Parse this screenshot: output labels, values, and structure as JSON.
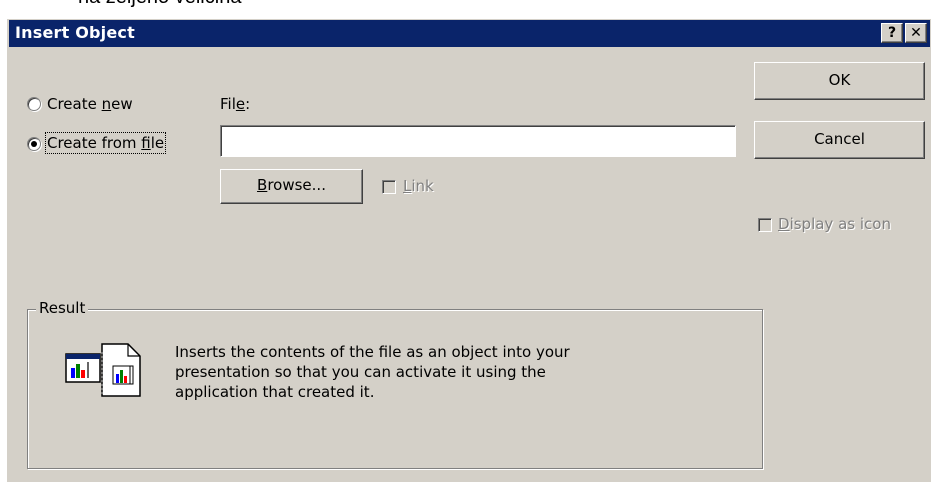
{
  "background_text": "na zeljeno velicina",
  "window": {
    "title": "Insert Object",
    "help_button": "?",
    "close_button": "✕"
  },
  "options": {
    "create_new": {
      "pre": "Create ",
      "key": "n",
      "post": "ew",
      "selected": false
    },
    "create_from_file": {
      "pre": "Create from ",
      "key": "f",
      "post": "ile",
      "selected": true
    }
  },
  "file": {
    "label_pre": "Fil",
    "label_key": "e",
    "label_post": ":",
    "value": ""
  },
  "browse_button": {
    "key": "B",
    "rest": "rowse..."
  },
  "link_checkbox": {
    "key": "L",
    "rest": "ink",
    "checked": false,
    "enabled": false
  },
  "ok_button": "OK",
  "cancel_button": "Cancel",
  "display_as_icon": {
    "key": "D",
    "rest": "isplay as icon",
    "checked": false,
    "enabled": false
  },
  "result": {
    "legend": "Result",
    "lines": [
      "Inserts the contents of the file as an object into your",
      "presentation so that you can activate it using the",
      "application that created it."
    ],
    "icon": "embedded-file-chart-icon"
  },
  "colors": {
    "titlebar": "#0a246a",
    "face": "#d4d0c8"
  }
}
